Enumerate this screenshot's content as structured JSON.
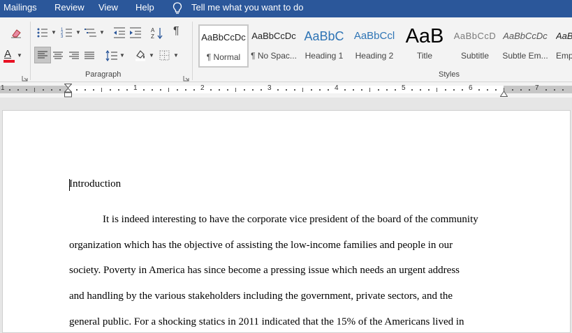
{
  "tabs": [
    {
      "label": "Mailings"
    },
    {
      "label": "Review"
    },
    {
      "label": "View"
    },
    {
      "label": "Help"
    }
  ],
  "tellme": {
    "label": "Tell me what you want to do"
  },
  "ribbon": {
    "paragraph_label": "Paragraph",
    "styles_label": "Styles",
    "font_color_glyph": "A",
    "pilcrow_glyph": "¶",
    "styles": [
      {
        "sample": "AaBbCcDc",
        "name": "¶ Normal"
      },
      {
        "sample": "AaBbCcDc",
        "name": "¶ No Spac..."
      },
      {
        "sample": "AaBbC",
        "name": "Heading 1"
      },
      {
        "sample": "AaBbCcl",
        "name": "Heading 2"
      },
      {
        "sample": "AaB",
        "name": "Title"
      },
      {
        "sample": "AaBbCcD",
        "name": "Subtitle"
      },
      {
        "sample": "AaBbCcDc",
        "name": "Subtle Em..."
      },
      {
        "sample": "AaBbCcDc",
        "name": "Emp"
      }
    ]
  },
  "ruler": {
    "numbers": [
      "1",
      "1",
      "2",
      "3",
      "4",
      "5",
      "6",
      "7"
    ]
  },
  "document": {
    "heading": "Introduction",
    "lines": [
      "It is indeed interesting to have the corporate vice president of the board of the community",
      "organization which has the objective of assisting the low-income families and people in our",
      "society. Poverty in America has since become a pressing issue which needs an urgent address",
      "and handling by the various stakeholders including the government, private sectors, and the",
      "general public. For a shocking statics in 2011 indicated that the 15% of the Americans lived in"
    ]
  },
  "colors": {
    "tabbar": "#2b579a",
    "font_color_bar": "#e81123",
    "ribbon": "#f3f3f3"
  }
}
